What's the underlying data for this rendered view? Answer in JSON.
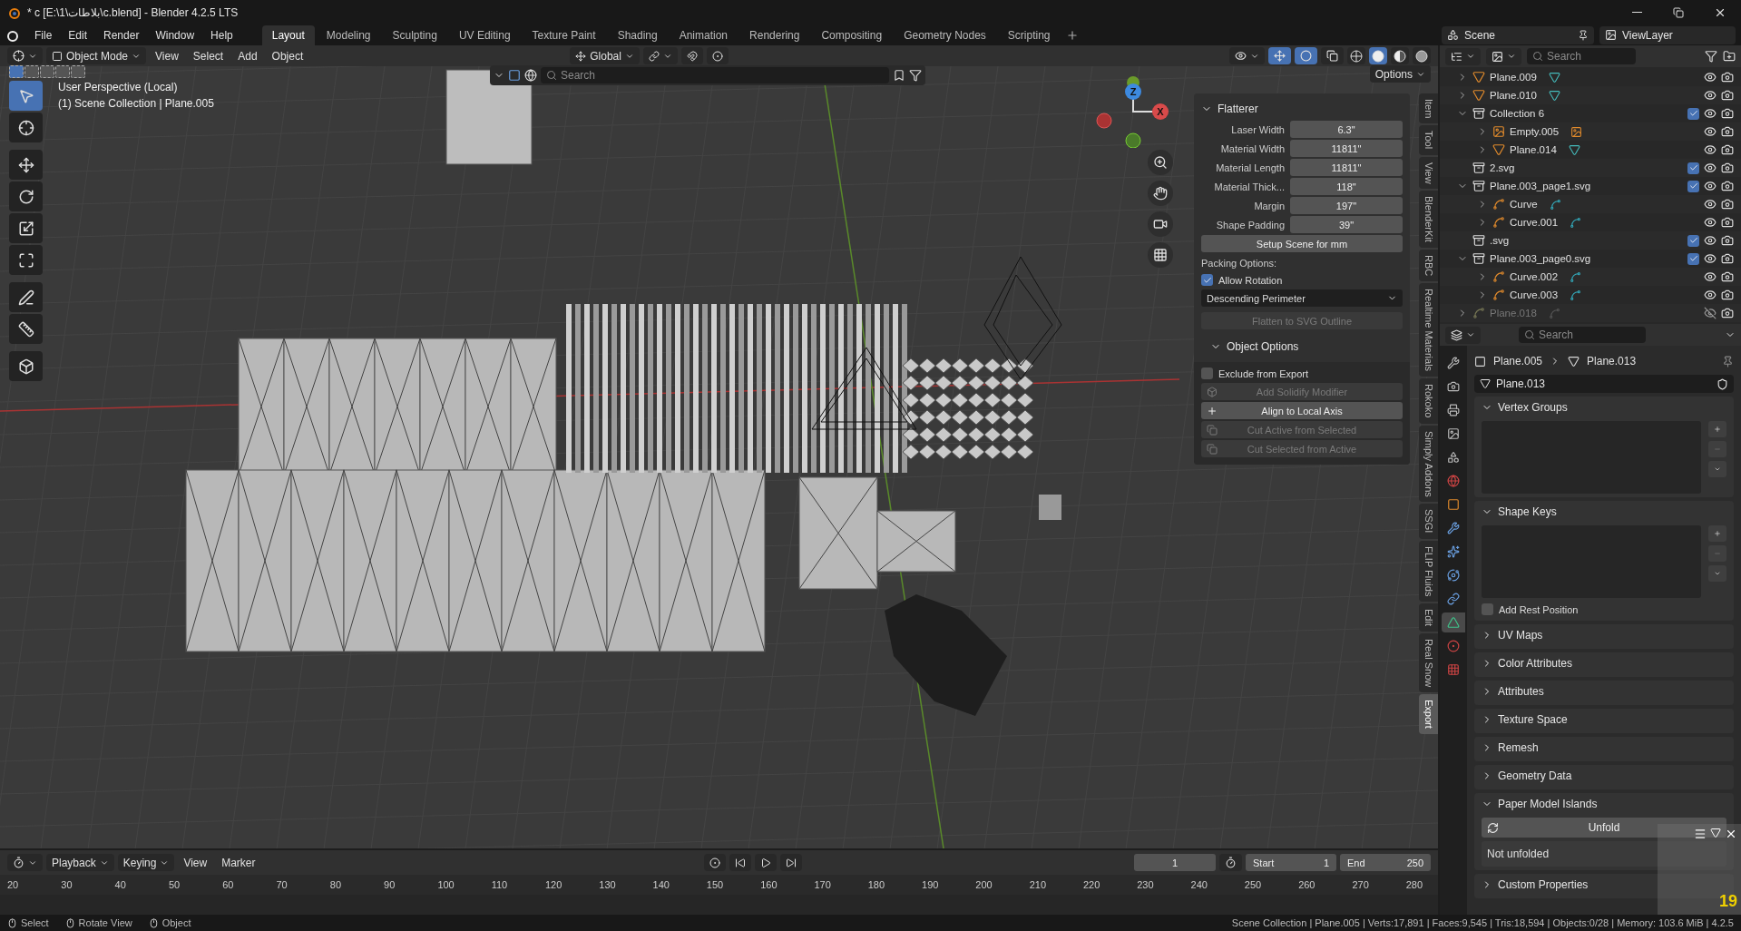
{
  "window": {
    "title": "* c [E:\\1\\بلاطات\\c.blend] - Blender 4.2.5 LTS"
  },
  "menu": [
    "File",
    "Edit",
    "Render",
    "Window",
    "Help"
  ],
  "workspaces": [
    {
      "label": "Layout",
      "selected": true
    },
    {
      "label": "Modeling",
      "selected": false
    },
    {
      "label": "Sculpting",
      "selected": false
    },
    {
      "label": "UV Editing",
      "selected": false
    },
    {
      "label": "Texture Paint",
      "selected": false
    },
    {
      "label": "Shading",
      "selected": false
    },
    {
      "label": "Animation",
      "selected": false
    },
    {
      "label": "Rendering",
      "selected": false
    },
    {
      "label": "Compositing",
      "selected": false
    },
    {
      "label": "Geometry Nodes",
      "selected": false
    },
    {
      "label": "Scripting",
      "selected": false
    }
  ],
  "scene": {
    "name": "Scene"
  },
  "view_layer": {
    "name": "ViewLayer"
  },
  "viewport": {
    "mode": "Object Mode",
    "menus": [
      "View",
      "Select",
      "Add",
      "Object"
    ],
    "orientation": "Global",
    "options": "Options",
    "search": {
      "placeholder": "Search"
    },
    "info": [
      "User Perspective (Local)",
      "(1) Scene Collection | Plane.005"
    ],
    "axes": [
      "Z",
      "X"
    ],
    "shading": [
      {
        "kind": "wireframe",
        "selected": false
      },
      {
        "kind": "solid",
        "selected": true
      },
      {
        "kind": "material",
        "selected": false
      },
      {
        "kind": "rendered",
        "selected": false
      }
    ],
    "tools": [
      {
        "kind": "select",
        "selected": true
      },
      {
        "kind": "cursor",
        "selected": false
      },
      {
        "kind": "move",
        "selected": false
      },
      {
        "kind": "rotate",
        "selected": false
      },
      {
        "kind": "scale",
        "selected": false
      },
      {
        "kind": "transform",
        "selected": false
      },
      {
        "kind": "annotate",
        "selected": false
      },
      {
        "kind": "measure",
        "selected": false
      },
      {
        "kind": "add-cube",
        "selected": false
      }
    ]
  },
  "sidebar_tabs": [
    {
      "label": "Item",
      "selected": false
    },
    {
      "label": "Tool",
      "selected": false
    },
    {
      "label": "View",
      "selected": false
    },
    {
      "label": "BlenderKit",
      "selected": false
    },
    {
      "label": "RBC",
      "selected": false
    },
    {
      "label": "Realtime Materials",
      "selected": false
    },
    {
      "label": "Rokoko",
      "selected": false
    },
    {
      "label": "Simply Addons",
      "selected": false
    },
    {
      "label": "SSGI",
      "selected": false
    },
    {
      "label": "FLIP Fluids",
      "selected": false
    },
    {
      "label": "Edit",
      "selected": false
    },
    {
      "label": "Real Snow",
      "selected": false
    },
    {
      "label": "Export",
      "selected": true
    }
  ],
  "flatterer": {
    "title": "Flatterer",
    "expanded": true,
    "fields": [
      {
        "label": "Laser Width",
        "value": "6.3\""
      },
      {
        "label": "Material Width",
        "value": "11811\""
      },
      {
        "label": "Material Length",
        "value": "11811\""
      },
      {
        "label": "Material Thick...",
        "value": "118\""
      },
      {
        "label": "Margin",
        "value": "197\""
      },
      {
        "label": "Shape Padding",
        "value": "39\""
      }
    ],
    "setup_button": "Setup Scene for mm",
    "packing_label": "Packing Options:",
    "allow_rotation": {
      "label": "Allow Rotation",
      "checked": true
    },
    "sort": "Descending Perimeter",
    "flatten_button": {
      "label": "Flatten to SVG Outline",
      "disabled": true
    },
    "object_options": {
      "title": "Object Options",
      "expanded": true,
      "exclude": {
        "label": "Exclude from Export",
        "checked": false
      },
      "buttons": [
        {
          "label": "Add Solidify Modifier",
          "disabled": true,
          "kind": "solidify"
        },
        {
          "label": "Align to Local Axis",
          "disabled": false,
          "kind": "axis"
        },
        {
          "label": "Cut Active from Selected",
          "disabled": true,
          "kind": "cut"
        },
        {
          "label": "Cut Selected from Active",
          "disabled": true,
          "kind": "cut"
        }
      ]
    }
  },
  "outliner": {
    "search": {
      "placeholder": "Search"
    },
    "items": [
      {
        "name": "Plane.009",
        "kind": "mesh",
        "visible": true
      },
      {
        "name": "Plane.010",
        "kind": "mesh",
        "visible": true
      },
      {
        "name": "Collection 6",
        "kind": "collection",
        "visible": true,
        "included": true,
        "expanded": true,
        "children": [
          {
            "name": "Empty.005",
            "kind": "empty",
            "visible": true
          },
          {
            "name": "Plane.014",
            "kind": "mesh",
            "visible": true
          }
        ]
      },
      {
        "name": "2.svg",
        "kind": "collection",
        "visible": true,
        "included": true
      },
      {
        "name": "Plane.003_page1.svg",
        "kind": "collection",
        "visible": true,
        "included": true,
        "expanded": true,
        "children": [
          {
            "name": "Curve",
            "kind": "curve",
            "visible": true
          },
          {
            "name": "Curve.001",
            "kind": "curve",
            "visible": true
          }
        ]
      },
      {
        "name": ".svg",
        "kind": "collection",
        "visible": true,
        "included": true
      },
      {
        "name": "Plane.003_page0.svg",
        "kind": "collection",
        "visible": true,
        "included": true,
        "expanded": true,
        "children": [
          {
            "name": "Curve.002",
            "kind": "curve",
            "visible": true
          },
          {
            "name": "Curve.003",
            "kind": "curve",
            "visible": true
          }
        ]
      },
      {
        "name": "Plane.018",
        "kind": "curve",
        "visible": false
      }
    ]
  },
  "properties": {
    "search": {
      "placeholder": "Search"
    },
    "breadcrumb": [
      "Plane.005",
      "Plane.013"
    ],
    "data_name": "Plane.013",
    "tabs": [
      {
        "kind": "tool",
        "selected": false
      },
      {
        "kind": "render",
        "selected": false
      },
      {
        "kind": "output",
        "selected": false
      },
      {
        "kind": "view-layer",
        "selected": false
      },
      {
        "kind": "scene",
        "selected": false
      },
      {
        "kind": "world",
        "selected": false
      },
      {
        "kind": "object",
        "selected": false
      },
      {
        "kind": "modifiers",
        "selected": false
      },
      {
        "kind": "particles",
        "selected": false
      },
      {
        "kind": "physics",
        "selected": false
      },
      {
        "kind": "constraints",
        "selected": false
      },
      {
        "kind": "data",
        "selected": true
      },
      {
        "kind": "material",
        "selected": false
      },
      {
        "kind": "texture",
        "selected": false
      }
    ],
    "panels": [
      {
        "title": "Vertex Groups",
        "expanded": true,
        "kind": "list"
      },
      {
        "title": "Shape Keys",
        "expanded": true,
        "kind": "list",
        "checkbox": {
          "label": "Add Rest Position",
          "checked": false
        }
      },
      {
        "title": "UV Maps",
        "expanded": false
      },
      {
        "title": "Color Attributes",
        "expanded": false
      },
      {
        "title": "Attributes",
        "expanded": false
      },
      {
        "title": "Texture Space",
        "expanded": false
      },
      {
        "title": "Remesh",
        "expanded": false
      },
      {
        "title": "Geometry Data",
        "expanded": false
      },
      {
        "title": "Paper Model Islands",
        "expanded": true,
        "kind": "unfold",
        "button": "Unfold",
        "status": "Not unfolded"
      },
      {
        "title": "Custom Properties",
        "expanded": false
      }
    ]
  },
  "timeline": {
    "menus": [
      "Playback",
      "Keying",
      "View",
      "Marker"
    ],
    "current_frame": "1",
    "start_label": "Start",
    "start": "1",
    "end_label": "End",
    "end": "250",
    "ticks": [
      "20",
      "30",
      "40",
      "50",
      "60",
      "70",
      "80",
      "90",
      "100",
      "110",
      "120",
      "130",
      "140",
      "150",
      "160",
      "170",
      "180",
      "190",
      "200",
      "210",
      "220",
      "230",
      "240",
      "250",
      "260",
      "270",
      "280"
    ]
  },
  "recorder_overlay": {
    "count": "19"
  },
  "status_bar": {
    "hints": [
      "Select",
      "Rotate View",
      "Object"
    ],
    "stats": "Scene Collection | Plane.005 | Verts:17,891 | Faces:9,545 | Tris:18,594 | Objects:0/28 | Memory: 103.6 MiB | 4.2.5"
  }
}
